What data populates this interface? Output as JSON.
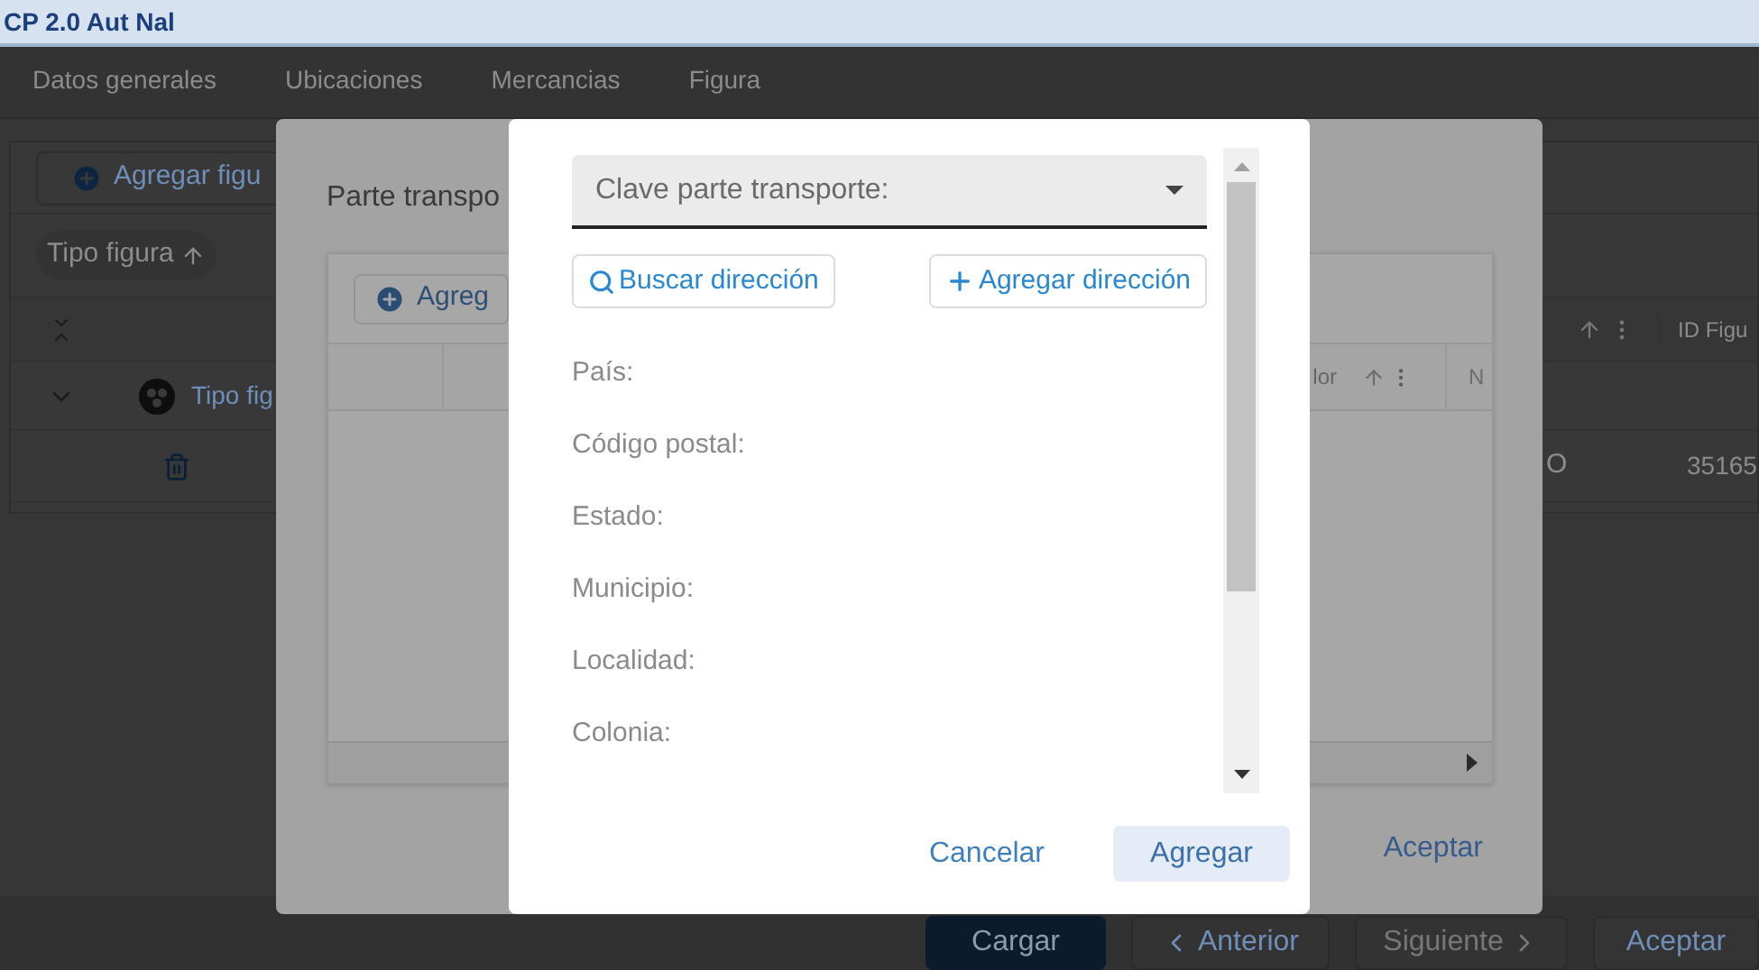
{
  "window": {
    "title": "CP 2.0 Aut Nal"
  },
  "tabs": [
    {
      "label": "Datos generales",
      "selected": false
    },
    {
      "label": "Ubicaciones",
      "selected": false
    },
    {
      "label": "Mercancias",
      "selected": false
    },
    {
      "label": "Figura",
      "selected": false
    }
  ],
  "figures": {
    "add_button": "Agregar figu",
    "sort_chip": "Tipo figura",
    "group_link": "Tipo fig",
    "column_5": "ID Figu",
    "cell_4": "O",
    "cell_5": "35165"
  },
  "footer_buttons": [
    {
      "label": "Cargar",
      "kind": "primary",
      "disabled": false
    },
    {
      "label": "Anterior",
      "kind": "back",
      "disabled": false
    },
    {
      "label": "Siguiente",
      "kind": "next",
      "disabled": true
    },
    {
      "label": "Aceptar",
      "kind": "plain",
      "disabled": false
    }
  ],
  "parte_dialog": {
    "title": "Parte transpo",
    "add_button": "Agreg",
    "column_3": "lor",
    "column_4": "N",
    "accept": "Aceptar"
  },
  "address_dialog": {
    "select": {
      "placeholder": "Clave parte transporte:"
    },
    "search_button": "Buscar dirección",
    "add_button": "Agregar dirección",
    "fields": [
      "País:",
      "Código postal:",
      "Estado:",
      "Municipio:",
      "Localidad:",
      "Colonia:"
    ],
    "cancel": "Cancelar",
    "submit": "Agregar"
  }
}
